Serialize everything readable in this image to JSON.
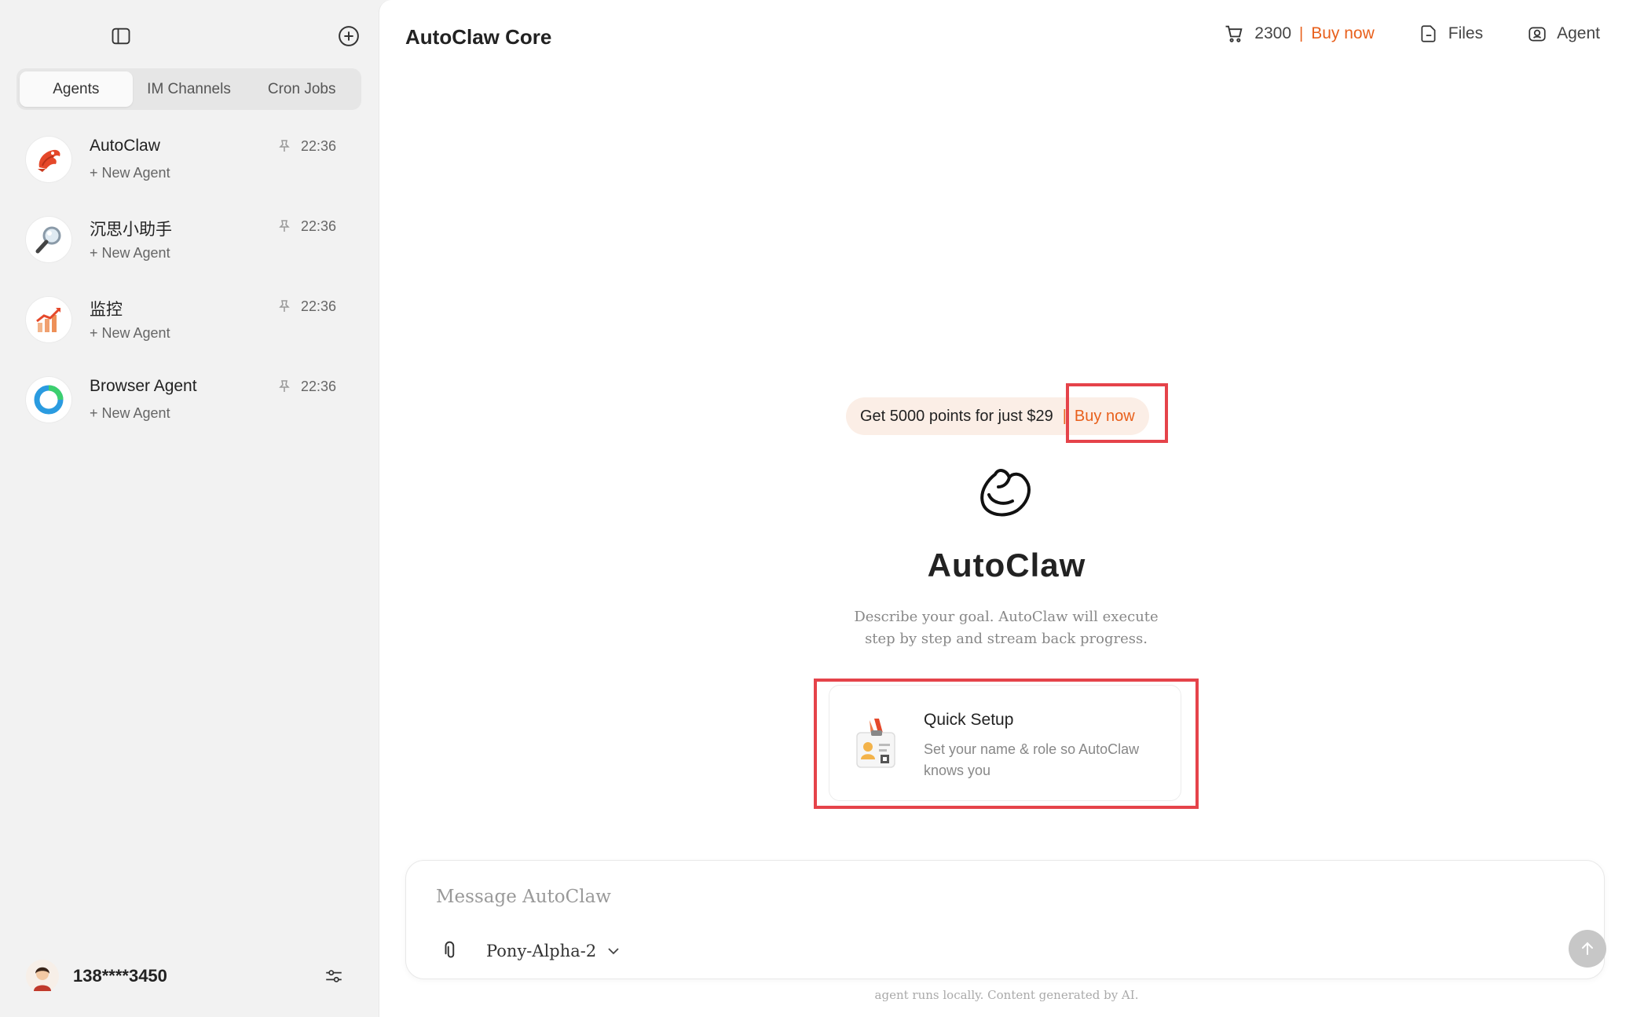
{
  "sidebar": {
    "tabs": [
      {
        "label": "Agents",
        "active": true
      },
      {
        "label": "IM Channels",
        "active": false
      },
      {
        "label": "Cron Jobs",
        "active": false
      }
    ],
    "agents": [
      {
        "name": "AutoClaw",
        "sub": "+ New Agent",
        "time": "22:36",
        "icon": "lobster-claw-icon"
      },
      {
        "name": "沉思小助手",
        "sub": "+ New Agent",
        "time": "22:36",
        "icon": "magnifier-icon"
      },
      {
        "name": "监控",
        "sub": "+ New Agent",
        "time": "22:36",
        "icon": "chart-icon"
      },
      {
        "name": "Browser Agent",
        "sub": "+ New Agent",
        "time": "22:36",
        "icon": "browser-ring-icon"
      }
    ],
    "user": {
      "name": "138****3450"
    }
  },
  "main": {
    "title": "AutoClaw Core",
    "topbar": {
      "points": "2300",
      "separator": "|",
      "buy_label": "Buy now",
      "files_label": "Files",
      "agent_label": "Agent"
    },
    "promo": {
      "text": "Get 5000 points for just $29",
      "separator": "|",
      "buy_label": "Buy now"
    },
    "hero": {
      "title": "AutoClaw",
      "description": "Describe your goal. AutoClaw will execute step by step and stream back progress."
    },
    "quick_setup": {
      "title": "Quick Setup",
      "description": "Set your name & role so AutoClaw knows you"
    },
    "composer": {
      "placeholder": "Message AutoClaw",
      "model": "Pony-Alpha-2"
    },
    "footnote": "agent runs locally. Content generated by AI."
  },
  "colors": {
    "accent": "#e8601c",
    "highlight": "#e5434a",
    "sidebar_bg": "#f2f2f2",
    "promo_bg": "#fbeee6"
  }
}
